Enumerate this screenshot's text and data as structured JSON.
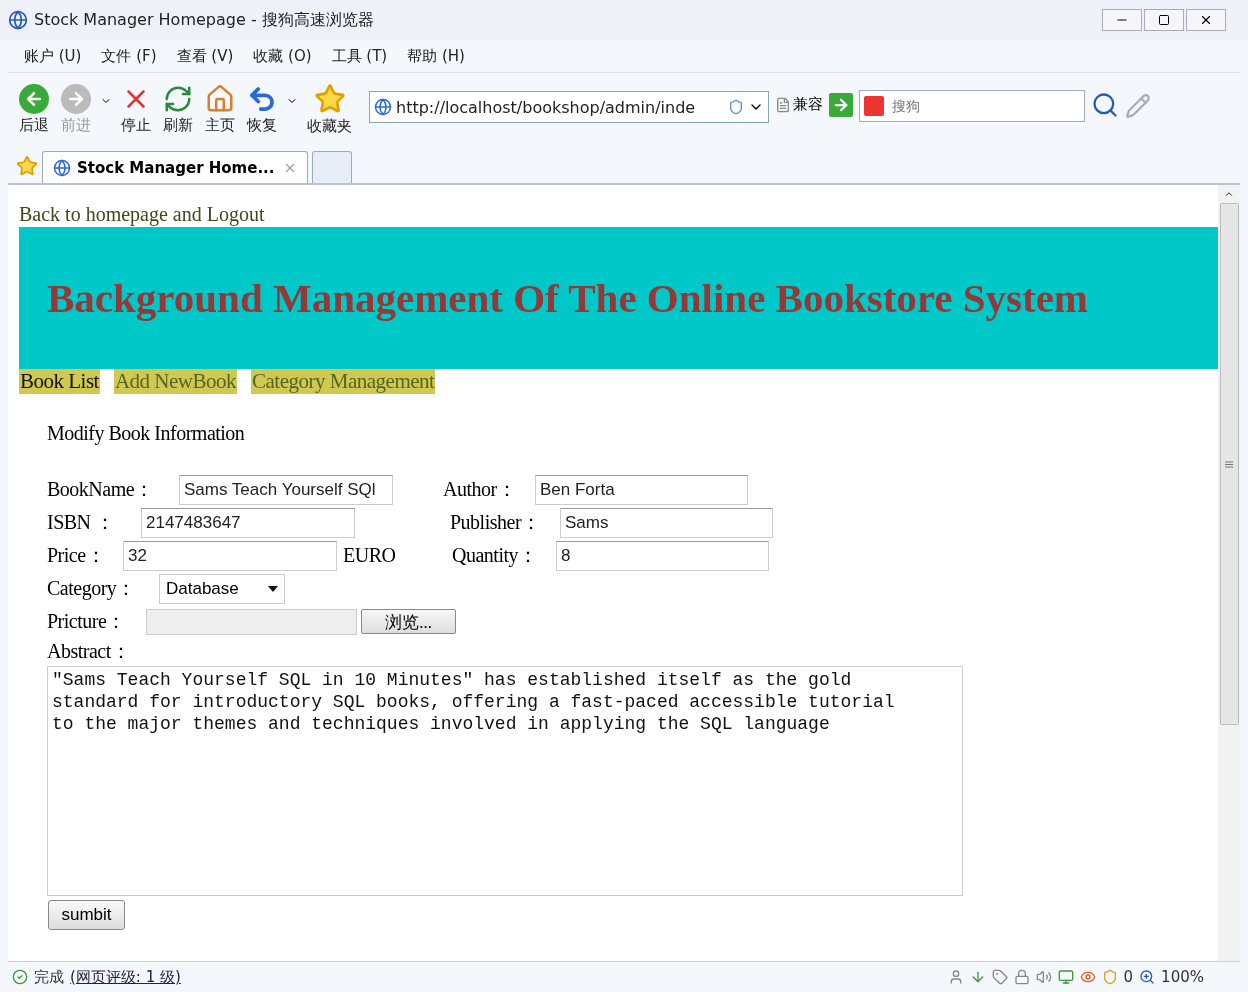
{
  "window": {
    "title": "Stock Manager Homepage - 搜狗高速浏览器"
  },
  "menu": [
    "账户 (U)",
    "文件 (F)",
    "查看 (V)",
    "收藏 (O)",
    "工具 (T)",
    "帮助 (H)"
  ],
  "toolbar": [
    {
      "kind": "back",
      "label": "后退",
      "disabled": false
    },
    {
      "kind": "forward",
      "label": "前进",
      "disabled": true
    },
    {
      "kind": "stop",
      "label": "停止",
      "disabled": false
    },
    {
      "kind": "refresh",
      "label": "刷新",
      "disabled": false
    },
    {
      "kind": "home",
      "label": "主页",
      "disabled": false
    },
    {
      "kind": "restore",
      "label": "恢复",
      "disabled": false
    },
    {
      "kind": "favorites",
      "label": "收藏夹",
      "disabled": false
    }
  ],
  "address": {
    "value": "http://localhost/bookshop/admin/inde",
    "compat": "兼容"
  },
  "search": {
    "placeholder": "搜狗"
  },
  "tabs": [
    {
      "label": "Stock Manager Home...",
      "selected": true
    }
  ],
  "page": {
    "top_link": "Back to homepage and Logout",
    "banner": "Background Management Of The Online Bookstore System",
    "nav": [
      {
        "label": "Book List",
        "selected": true
      },
      {
        "label": "Add NewBook",
        "selected": false
      },
      {
        "label": "Category Management",
        "selected": false
      }
    ],
    "form_title": "Modify Book Information",
    "rows": [
      {
        "left": [
          {
            "kind": "label",
            "text": "BookName："
          },
          {
            "kind": "input",
            "value": "Sams Teach Yourself SQl"
          }
        ],
        "right": [
          {
            "kind": "label",
            "text": "Author："
          },
          {
            "kind": "input",
            "value": "Ben Forta"
          }
        ]
      },
      {
        "left": [
          {
            "kind": "label",
            "text": "ISBN ："
          },
          {
            "kind": "input",
            "value": "2147483647"
          }
        ],
        "right": [
          {
            "kind": "label",
            "text": "Publisher："
          },
          {
            "kind": "input",
            "value": "Sams"
          }
        ]
      },
      {
        "left": [
          {
            "kind": "label",
            "text": "Price："
          },
          {
            "kind": "input",
            "value": "32"
          },
          {
            "kind": "unit",
            "text": "EURO"
          }
        ],
        "right": [
          {
            "kind": "label",
            "text": "Quantity："
          },
          {
            "kind": "input",
            "value": "8"
          }
        ]
      },
      {
        "left": [
          {
            "kind": "label",
            "text": "Category："
          },
          {
            "kind": "select",
            "value": "Database"
          }
        ]
      },
      {
        "left": [
          {
            "kind": "label",
            "text": "Pricture："
          },
          {
            "kind": "file",
            "button": "浏览..."
          }
        ]
      }
    ],
    "abstract_label": "Abstract：",
    "abstract": "\"Sams Teach Yourself SQL in 10 Minutes\" has established itself as the gold standard for introductory SQL books, offering a fast-paced accessible tutorial to the major themes and techniques involved in applying the SQL language",
    "submit": "sumbit"
  },
  "status_bar": {
    "status": "完成",
    "rating": "(网页评级: 1 级)",
    "count": "0",
    "zoom": "100%"
  }
}
